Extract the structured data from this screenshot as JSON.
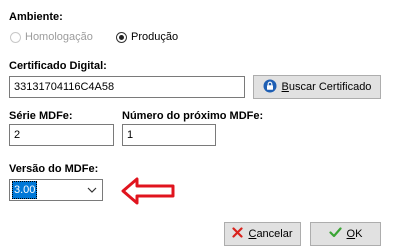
{
  "ambiente": {
    "label": "Ambiente:",
    "options": [
      {
        "label": "Homologação",
        "selected": false,
        "disabled": true
      },
      {
        "label": "Produção",
        "selected": true,
        "disabled": false
      }
    ]
  },
  "certificado": {
    "label": "Certificado Digital:",
    "value": "33131704116C4A58",
    "buscar_label": "Buscar Certificado",
    "buscar_mnemonic": "B"
  },
  "serie": {
    "label": "Série MDFe:",
    "value": "2"
  },
  "numero": {
    "label": "Número do próximo MDFe:",
    "value": "1"
  },
  "versao": {
    "label": "Versão do MDFe:",
    "value": "3.00"
  },
  "buttons": {
    "cancelar": "Cancelar",
    "ok": "OK"
  },
  "colors": {
    "selection": "#0078d7",
    "arrow": "#e0141e",
    "cancel_icon": "#d9231d",
    "ok_icon": "#3aa535"
  },
  "icons": {
    "lock": "lock-icon",
    "cancel": "x-icon",
    "ok": "check-icon",
    "dropdown": "chevron-down-icon"
  }
}
